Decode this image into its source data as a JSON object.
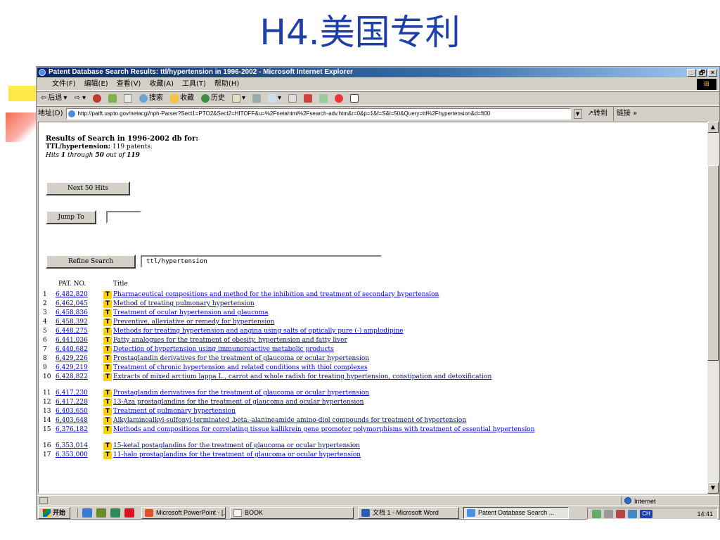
{
  "slide": {
    "title": "H4.美国专利"
  },
  "window": {
    "title": "Patent Database Search Results: ttl/hypertension in 1996-2002 - Microsoft Internet Explorer",
    "controls": [
      "_",
      "🗗",
      "×"
    ]
  },
  "menu": [
    "文件(F)",
    "编辑(E)",
    "查看(V)",
    "收藏(A)",
    "工具(T)",
    "帮助(H)"
  ],
  "toolbar": {
    "back": "后退",
    "search": "搜索",
    "favorites": "收藏",
    "history": "历史"
  },
  "address": {
    "label": "地址(D)",
    "url": "http://patft.uspto.gov/netacgi/nph-Parser?Sect1=PTO2&Sect2=HITOFF&u=%2Fnetahtml%2Fsearch-adv.htm&r=0&p=1&f=S&l=50&Query=ttl%2Fhypertension&d=ft00",
    "go": "转到",
    "links": "链接 »"
  },
  "results": {
    "heading": "Results of Search in 1996-2002 db for:",
    "query": "TTL/hypertension:",
    "count_text": "119 patents.",
    "hits_prefix": "Hits",
    "hits_from": "1",
    "hits_through": "through",
    "hits_to": "50",
    "hits_outof": "out of",
    "hits_total": "119"
  },
  "buttons": {
    "next": "Next 50 Hits",
    "jump": "Jump To",
    "refine": "Refine Search"
  },
  "refine_value": "ttl/hypertension",
  "columns": {
    "pat_no": "PAT. NO.",
    "title": "Title"
  },
  "rows": [
    {
      "num": "1",
      "pat": "6,482,820",
      "title": "Pharmaceutical compositions and method for the inhibition and treatment of secondary hypertension"
    },
    {
      "num": "2",
      "pat": "6,462,045",
      "title": "Method of treating pulmonary hypertension"
    },
    {
      "num": "3",
      "pat": "6,458,836",
      "title": "Treatment of ocular hypertension and glaucoma"
    },
    {
      "num": "4",
      "pat": "6,458,392",
      "title": "Preventive, alleviative or remedy for hypertension"
    },
    {
      "num": "5",
      "pat": "6,448,275",
      "title": "Methods for treating hypertension and angina using salts of optically pure (-) amplodipine"
    },
    {
      "num": "6",
      "pat": "6,441,036",
      "title": "Fatty analogues for the treatment of obesity, hypertension and fatty liver"
    },
    {
      "num": "7",
      "pat": "6,440,682",
      "title": "Detection of hypertension using immunoreactive metabolic products"
    },
    {
      "num": "8",
      "pat": "6,429,226",
      "title": "Prostaglandin derivatives for the treatment of glaucoma or ocular hypertension"
    },
    {
      "num": "9",
      "pat": "6,429,219",
      "title": "Treatment of chronic hypertension and related conditions with thiol complexes"
    },
    {
      "num": "10",
      "pat": "6,428,822",
      "title": "Extracts of mixed arctium lappa L., carrot and whole radish for treating hypertension, constipation and detoxification"
    },
    {
      "num": "11",
      "pat": "6,417,230",
      "title": "Prostaglandin derivatives for the treatment of glaucoma or ocular hypertension"
    },
    {
      "num": "12",
      "pat": "6,417,228",
      "title": "13-Aza prostaglandins for the treatment of glaucoma and ocular hypertension"
    },
    {
      "num": "13",
      "pat": "6,403,650",
      "title": "Treatment of pulmonary hypertension"
    },
    {
      "num": "14",
      "pat": "6,403,648",
      "title": "Alkylaminoalkyl-sulfonyl-terminated .beta.-alanineamide amino-diol compounds for treatment of hypertension"
    },
    {
      "num": "15",
      "pat": "6,376,182",
      "title": "Methods and compositions for correlating tissue kallikrein gene promoter polymorphisms with treatment of essential hypertension"
    },
    {
      "num": "16",
      "pat": "6,353,014",
      "title": "15-ketal postaglandins for the treatment of glaucoma or ocular hypertension"
    },
    {
      "num": "17",
      "pat": "6,353,000",
      "title": "11-halo prostaglandins for the treatment of glaucoma or ocular hypertension"
    }
  ],
  "row_icon": "T",
  "status": {
    "zone": "Internet"
  },
  "taskbar": {
    "start": "开始",
    "tasks": [
      "Microsoft PowerPoint - [...",
      "BOOK",
      "文档 1 - Microsoft Word",
      "Patent Database Search ..."
    ],
    "ime": "CH",
    "clock": "14:41"
  },
  "colors": {
    "title": "#1f3fa8",
    "link": "#0000cc",
    "titlebar": "#0a246a",
    "t_icon": "#ffd000"
  }
}
